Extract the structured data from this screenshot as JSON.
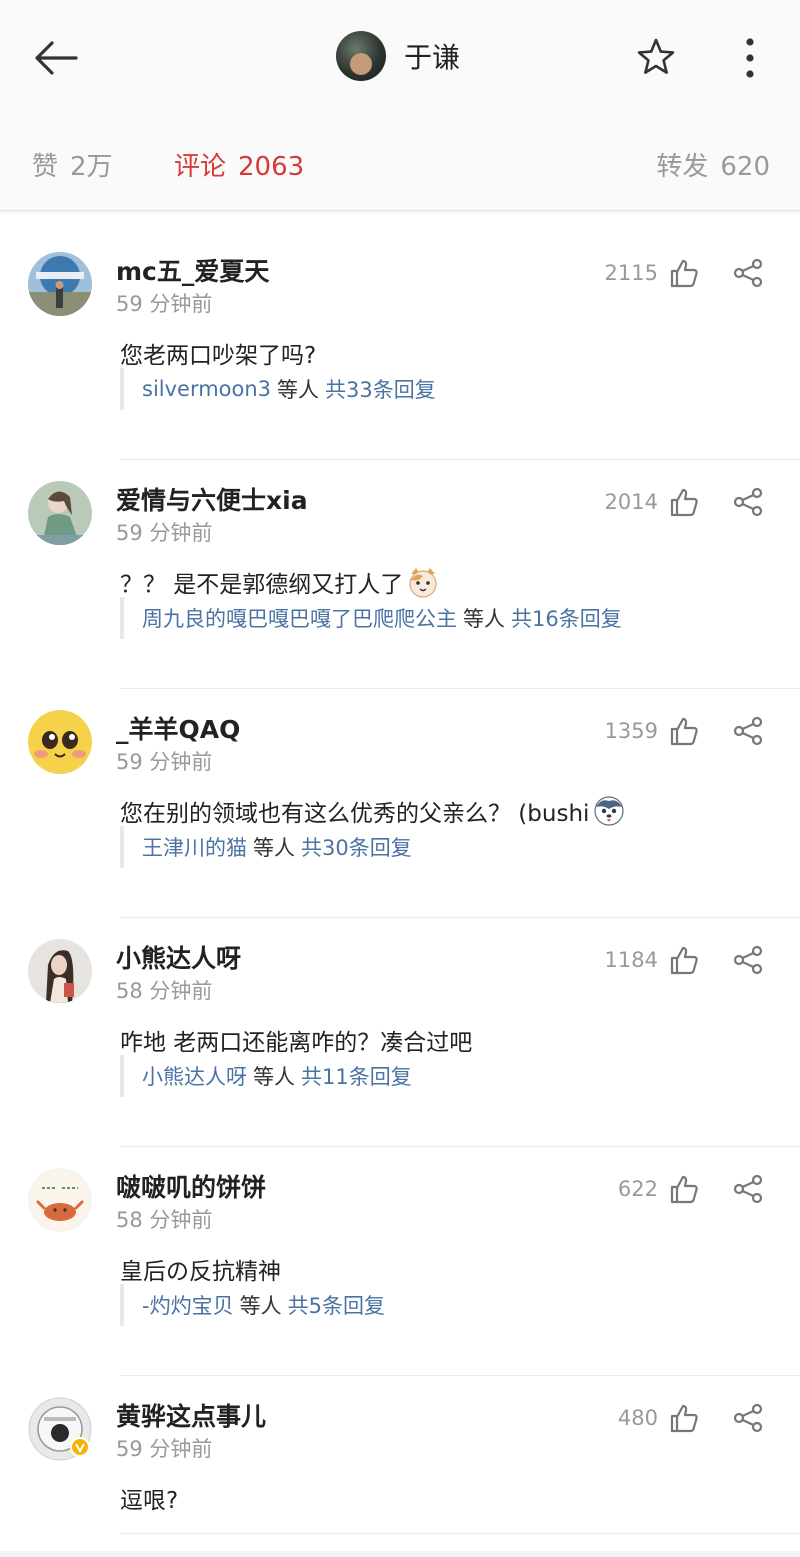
{
  "header": {
    "title": "于谦",
    "icons": {
      "back": "arrow-left-icon",
      "favorite": "star-outline-icon",
      "more": "more-vertical-icon"
    }
  },
  "stats": {
    "likes_label": "赞",
    "likes_value": "2万",
    "comments_label": "评论",
    "comments_value": "2063",
    "reposts_label": "转发",
    "reposts_value": "620",
    "active_color": "#d43a3a"
  },
  "comments": [
    {
      "username": "mc五_爱夏天",
      "time": "59 分钟前",
      "likes": "2115",
      "text": "您老两口吵架了吗?",
      "emoji": "",
      "reply_user": "silvermoon3",
      "reply_mid": "等人",
      "reply_count": "共33条回复",
      "avatar": "theme-park-photo"
    },
    {
      "username": "爱情与六便士xia",
      "time": "59 分钟前",
      "likes": "2014",
      "text": "？？ 是不是郭德纲又打人了",
      "emoji": "cat-face-emoji",
      "reply_user": "周九良的嘎巴嘎巴嘎了巴爬爬公主",
      "reply_mid": "等人",
      "reply_count": "共16条回复",
      "avatar": "illustration-girl"
    },
    {
      "username": "_羊羊QAQ",
      "time": "59 分钟前",
      "likes": "1359",
      "text": "您在别的领域也有这么优秀的父亲么？ (bushi",
      "emoji": "husky-face-emoji",
      "reply_user": "王津川的猫",
      "reply_mid": "等人",
      "reply_count": "共30条回复",
      "avatar": "yellow-smiley-face"
    },
    {
      "username": "小熊达人呀",
      "time": "58 分钟前",
      "likes": "1184",
      "text": "咋地 老两口还能离咋的？凑合过吧",
      "emoji": "",
      "reply_user": "小熊达人呀",
      "reply_mid": "等人",
      "reply_count": "共11条回复",
      "avatar": "person-photo"
    },
    {
      "username": "啵啵叽的饼饼",
      "time": "58 分钟前",
      "likes": "622",
      "text": "皇后の反抗精神",
      "emoji": "",
      "reply_user": "-灼灼宝贝",
      "reply_mid": "等人",
      "reply_count": "共5条回复",
      "avatar": "cartoon-crab"
    },
    {
      "username": "黄骅这点事儿",
      "time": "59 分钟前",
      "likes": "480",
      "text": "逗哏?",
      "emoji": "",
      "reply_user": "",
      "reply_mid": "",
      "reply_count": "",
      "avatar": "round-logo-verified"
    }
  ],
  "comment_icons": {
    "like": "thumbs-up-icon",
    "share": "share-icon"
  },
  "link_color": "#4a73a4"
}
